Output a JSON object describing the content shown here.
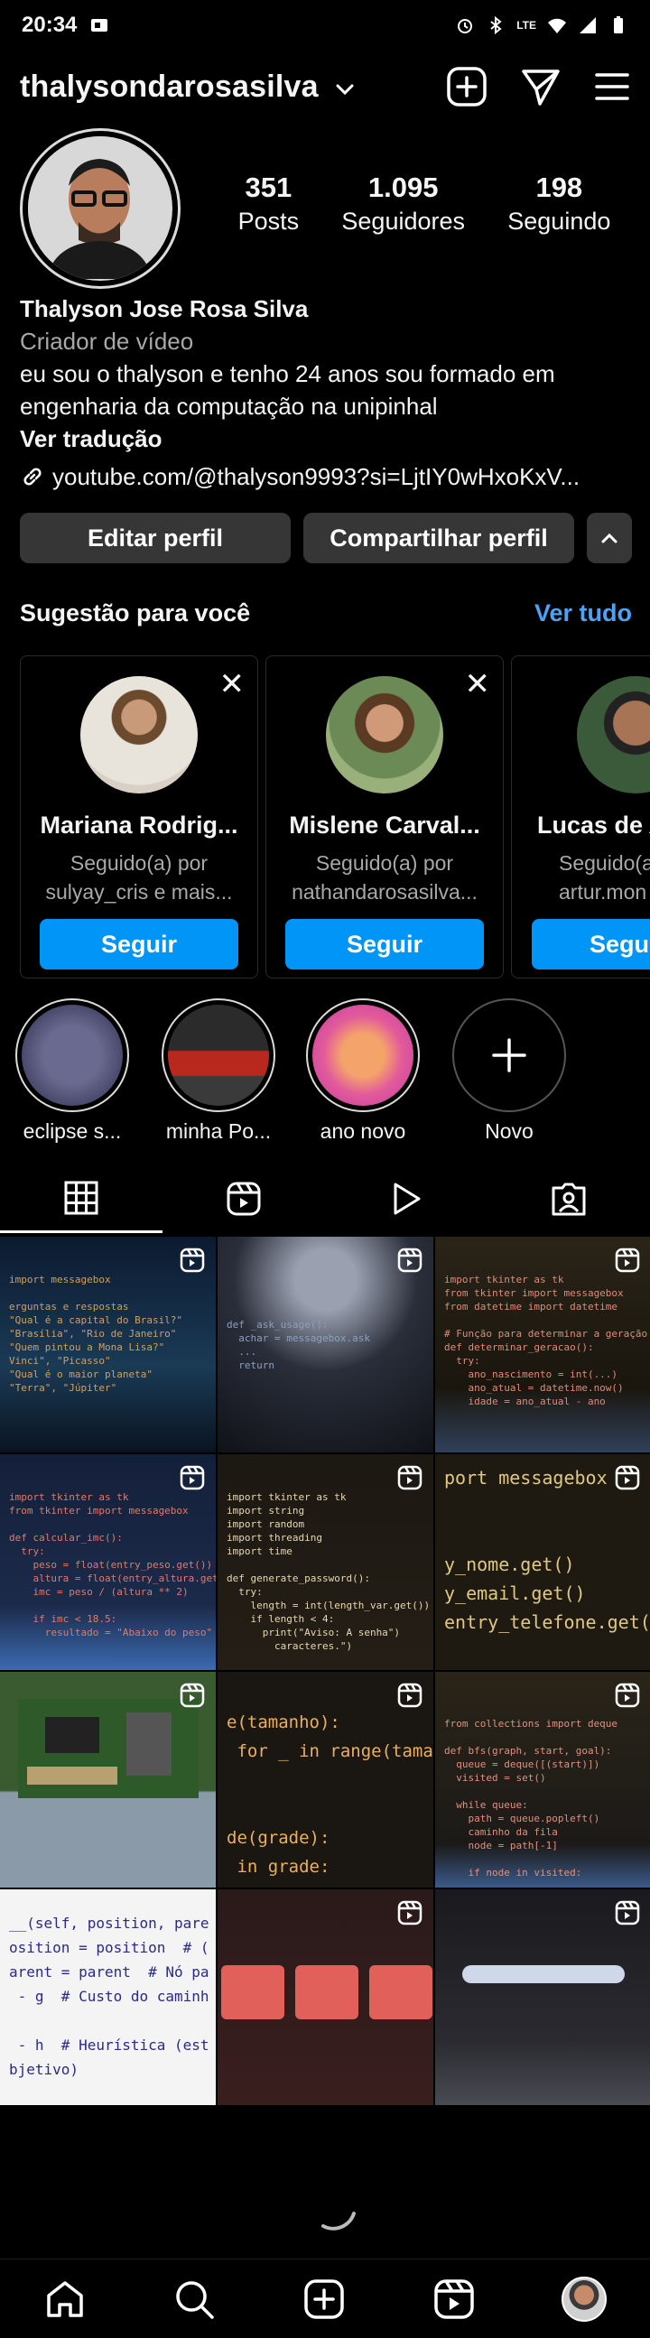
{
  "status_bar": {
    "time": "20:34",
    "net": "LTE"
  },
  "header": {
    "username": "thalysondarosasilva"
  },
  "profile": {
    "stats": [
      {
        "num": "351",
        "label": "Posts"
      },
      {
        "num": "1.095",
        "label": "Seguidores"
      },
      {
        "num": "198",
        "label": "Seguindo"
      }
    ],
    "name": "Thalyson Jose Rosa Silva",
    "category": "Criador de vídeo",
    "bio_line1": "eu sou o thalyson e tenho 24 anos  sou formado em",
    "bio_line2": "engenharia da computação na unipinhal",
    "see_translation": "Ver tradução",
    "link": "youtube.com/@thalyson9993?si=LjtIY0wHxoKxV..."
  },
  "buttons": {
    "edit": "Editar perfil",
    "share": "Compartilhar perfil"
  },
  "suggestions": {
    "title": "Sugestão para você",
    "see_all": "Ver tudo",
    "cards": [
      {
        "name": "Mariana Rodrig...",
        "line1": "Seguido(a) por",
        "line2": "sulyay_cris e mais...",
        "button": "Seguir"
      },
      {
        "name": "Mislene Carval...",
        "line1": "Seguido(a) por",
        "line2": "nathandarosasilva...",
        "button": "Seguir"
      },
      {
        "name": "Lucas de A",
        "line1": "Seguido(a",
        "line2": "artur.mon",
        "button": "Segu"
      }
    ]
  },
  "highlights": [
    {
      "label": "eclipse s..."
    },
    {
      "label": "minha Po..."
    },
    {
      "label": "ano novo"
    },
    {
      "label": "Novo"
    }
  ],
  "icons": {
    "topbar": [
      "chevron-down-icon",
      "new-post-icon",
      "direct-message-icon",
      "menu-icon"
    ],
    "tabs": [
      "grid-icon",
      "reels-icon",
      "play-icon",
      "tagged-icon"
    ],
    "bottom": [
      "home-icon",
      "search-icon",
      "create-icon",
      "reels-icon",
      "profile-avatar"
    ]
  },
  "colors": {
    "accent": "#0095f6",
    "link": "#4aa3f5",
    "button": "#363636"
  }
}
